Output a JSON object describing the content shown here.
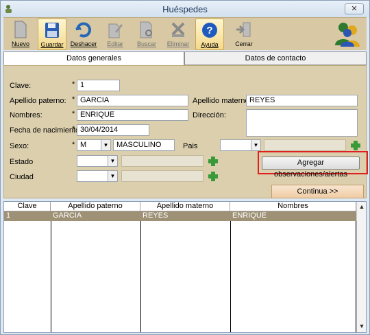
{
  "window": {
    "title": "Huéspedes",
    "close_label": "✕"
  },
  "toolbar": {
    "items": [
      {
        "label": "Nuevo"
      },
      {
        "label": "Guardar"
      },
      {
        "label": "Deshacer"
      },
      {
        "label": "Editar"
      },
      {
        "label": "Buscar"
      },
      {
        "label": "Eliminar"
      },
      {
        "label": "Ayuda"
      },
      {
        "label": "Cerrar"
      }
    ]
  },
  "tabs": [
    {
      "label": "Datos generales"
    },
    {
      "label": "Datos de contacto"
    }
  ],
  "form": {
    "clave_label": "Clave:",
    "clave_value": "1",
    "apellido_paterno_label": "Apellido paterno:",
    "apellido_paterno_value": "GARCIA",
    "apellido_materno_label": "Apellido materno:",
    "apellido_materno_value": "REYES",
    "nombres_label": "Nombres:",
    "nombres_value": "ENRIQUE",
    "direccion_label": "Dirección:",
    "direccion_value": "",
    "fecha_label": "Fecha de nacimiento:",
    "fecha_value": "30/04/2014",
    "sexo_label": "Sexo:",
    "sexo_code": "M",
    "sexo_desc": "MASCULINO",
    "pais_label": "Pais",
    "estado_label": "Estado",
    "ciudad_label": "Ciudad",
    "required_mark": "*",
    "obs_button": "Agregar observaciones/alertas",
    "continue_button": "Continua >>"
  },
  "table": {
    "columns": [
      "Clave",
      "Apellido paterno",
      "Apellido materno",
      "Nombres"
    ],
    "rows": [
      [
        "1",
        "GARCIA",
        "REYES",
        "ENRIQUE"
      ]
    ]
  },
  "colors": {
    "toolbar_bg": "#d8c9a4",
    "form_bg": "#dccfae",
    "selected_row": "#9e9175",
    "highlight": "#e02020"
  }
}
